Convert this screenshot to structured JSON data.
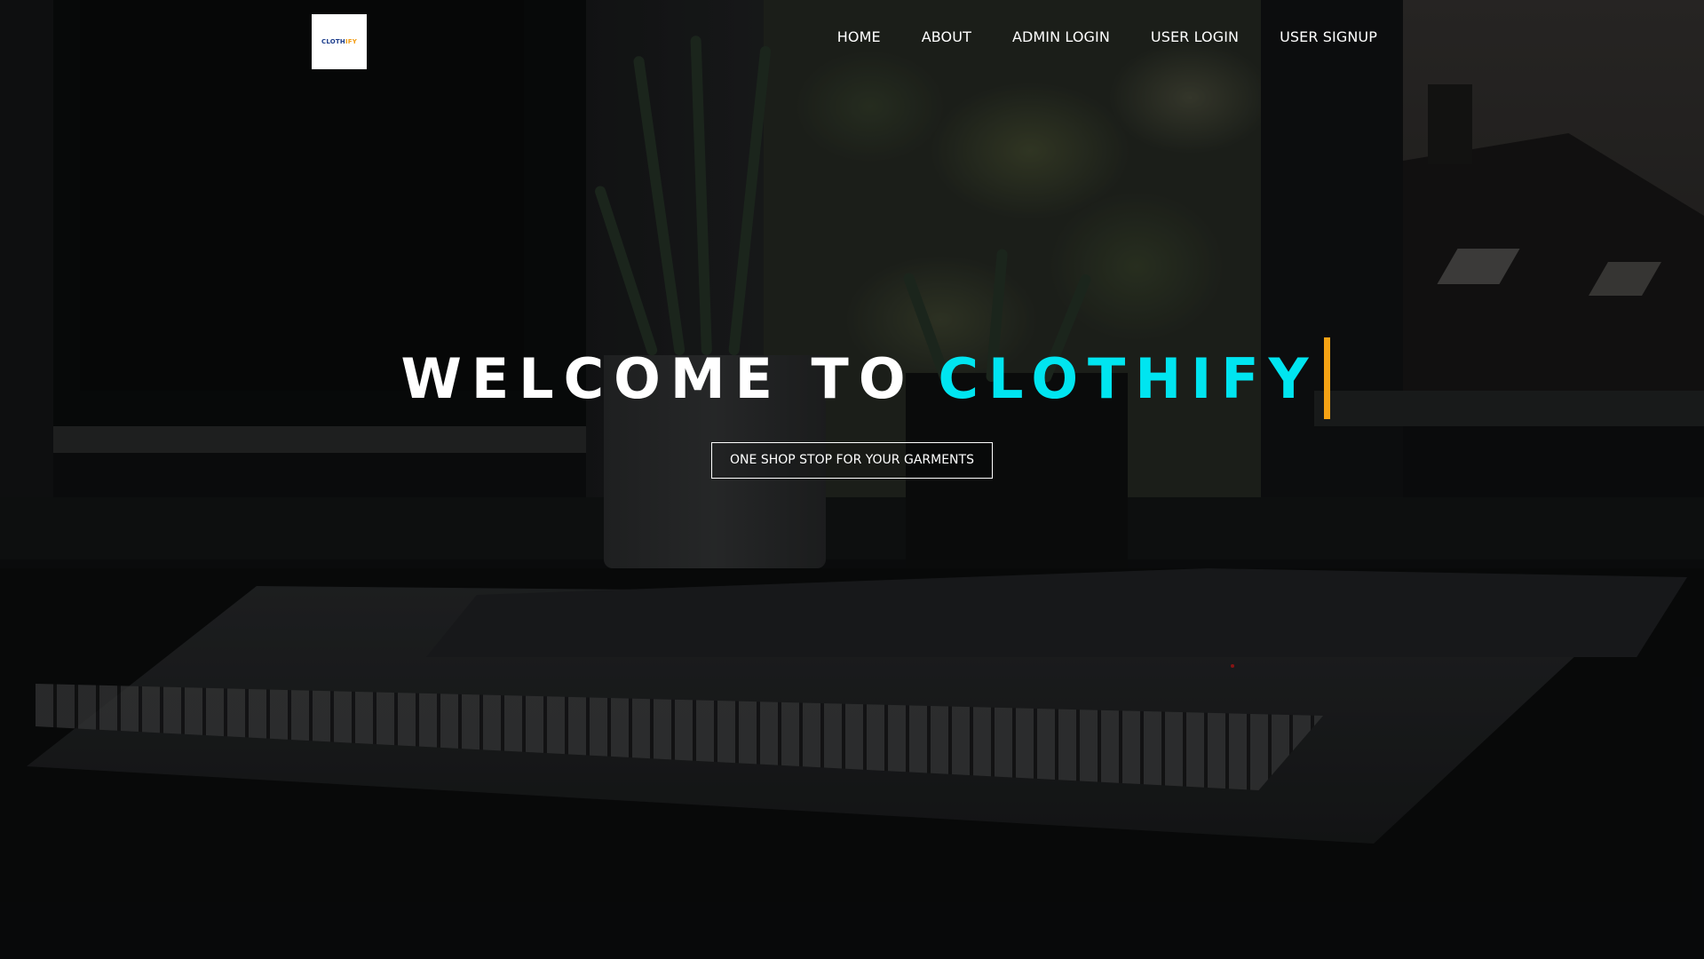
{
  "logo": {
    "text_main": "CLOTH",
    "text_accent": "IFY"
  },
  "nav": {
    "items": [
      "HOME",
      "ABOUT",
      "ADMIN LOGIN",
      "USER LOGIN",
      "USER SIGNUP"
    ]
  },
  "hero": {
    "title_prefix": "WELCOME TO",
    "title_brand": "CLOTHIFY",
    "cta_label": "ONE SHOP STOP FOR YOUR GARMENTS"
  },
  "colors": {
    "brand_accent": "#00e5f0",
    "cursor": "#f5a214",
    "nav_text": "#ffffff"
  },
  "icons": {
    "logo": "cart-logo-icon",
    "cursor": "typing-cursor"
  }
}
